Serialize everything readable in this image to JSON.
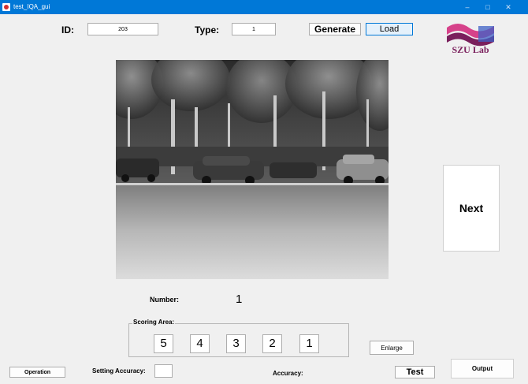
{
  "window": {
    "title": "test_IQA_gui",
    "minimize": "–",
    "maximize": "□",
    "close": "✕"
  },
  "header": {
    "id_label": "ID:",
    "id_value": "203",
    "type_label": "Type:",
    "type_value": "1",
    "generate_label": "Generate",
    "load_label": "Load"
  },
  "logo": {
    "text": "SZU Lab",
    "colors": [
      "#d6428a",
      "#7a1f5c",
      "#3f61c6"
    ]
  },
  "next_label": "Next",
  "number": {
    "label": "Number:",
    "value": "1"
  },
  "scoring": {
    "legend": "Scoring Area:",
    "scores": [
      "5",
      "4",
      "3",
      "2",
      "1"
    ]
  },
  "enlarge_label": "Enlarge",
  "footer": {
    "operation_label": "Operation",
    "setting_accuracy_label": "Setting Accuracy:",
    "setting_accuracy_value": "",
    "accuracy_label": "Accuracy:",
    "test_label": "Test",
    "output_label": "Output"
  },
  "colors": {
    "titlebar": "#0078d7",
    "window_bg": "#f0f0f0",
    "selected_button": "#e5f1fb",
    "selected_border": "#0078d7"
  }
}
